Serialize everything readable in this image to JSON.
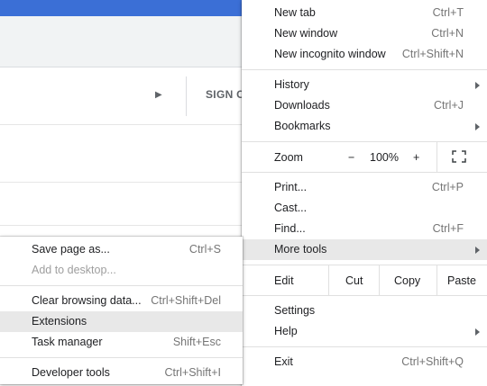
{
  "background": {
    "signin_label": "SIGN C"
  },
  "menu": {
    "new_tab": {
      "label": "New tab",
      "shortcut": "Ctrl+T"
    },
    "new_window": {
      "label": "New window",
      "shortcut": "Ctrl+N"
    },
    "new_incognito": {
      "label": "New incognito window",
      "shortcut": "Ctrl+Shift+N"
    },
    "history": {
      "label": "History"
    },
    "downloads": {
      "label": "Downloads",
      "shortcut": "Ctrl+J"
    },
    "bookmarks": {
      "label": "Bookmarks"
    },
    "zoom": {
      "label": "Zoom",
      "minus": "−",
      "level": "100%",
      "plus": "+"
    },
    "print": {
      "label": "Print...",
      "shortcut": "Ctrl+P"
    },
    "cast": {
      "label": "Cast..."
    },
    "find": {
      "label": "Find...",
      "shortcut": "Ctrl+F"
    },
    "more_tools": {
      "label": "More tools"
    },
    "edit": {
      "label": "Edit",
      "cut": "Cut",
      "copy": "Copy",
      "paste": "Paste"
    },
    "settings": {
      "label": "Settings"
    },
    "help": {
      "label": "Help"
    },
    "exit": {
      "label": "Exit",
      "shortcut": "Ctrl+Shift+Q"
    }
  },
  "submenu": {
    "save_page": {
      "label": "Save page as...",
      "shortcut": "Ctrl+S"
    },
    "add_desktop": {
      "label": "Add to desktop..."
    },
    "clear_data": {
      "label": "Clear browsing data...",
      "shortcut": "Ctrl+Shift+Del"
    },
    "extensions": {
      "label": "Extensions"
    },
    "task_manager": {
      "label": "Task manager",
      "shortcut": "Shift+Esc"
    },
    "dev_tools": {
      "label": "Developer tools",
      "shortcut": "Ctrl+Shift+I"
    }
  }
}
